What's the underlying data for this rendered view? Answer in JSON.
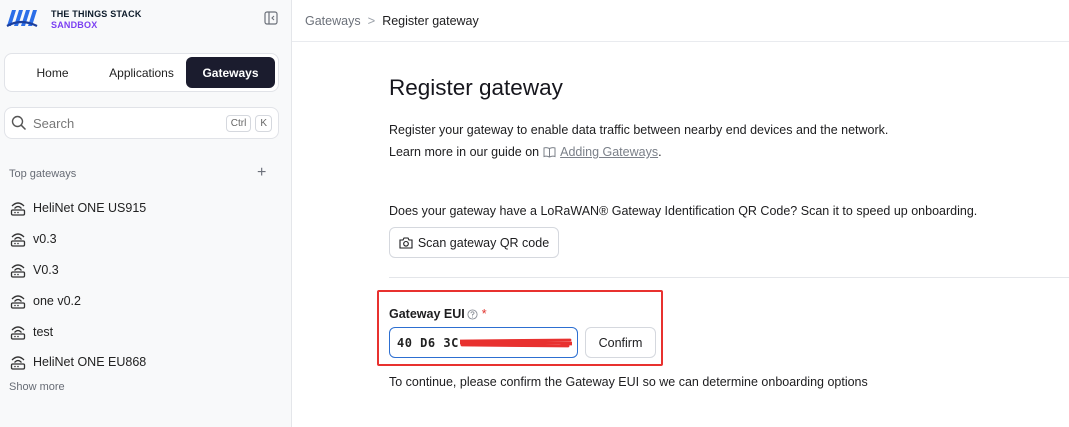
{
  "brand": {
    "line1": "THE THINGS STACK",
    "line2": "SANDBOX",
    "accent": "#7b3ff2"
  },
  "nav": {
    "tabs": [
      {
        "label": "Home"
      },
      {
        "label": "Applications"
      },
      {
        "label": "Gateways",
        "active": true
      }
    ]
  },
  "search": {
    "placeholder": "Search",
    "shortcut_key1": "Ctrl",
    "shortcut_key2": "K"
  },
  "sidebar": {
    "section_title": "Top gateways",
    "add_icon": "+",
    "gateways": [
      {
        "label": "HeliNet ONE US915"
      },
      {
        "label": "v0.3"
      },
      {
        "label": "V0.3"
      },
      {
        "label": "one v0.2"
      },
      {
        "label": "test"
      },
      {
        "label": "HeliNet ONE EU868"
      }
    ],
    "show_more": "Show more"
  },
  "breadcrumb": {
    "parent": "Gateways",
    "separator": ">",
    "current": "Register gateway"
  },
  "main": {
    "title": "Register gateway",
    "description": "Register your gateway to enable data traffic between nearby end devices and the network.",
    "guide_prefix": "Learn more in our guide on",
    "guide_link": "Adding Gateways",
    "guide_suffix": ".",
    "qr_question": "Does your gateway have a LoRaWAN® Gateway Identification QR Code? Scan it to speed up onboarding.",
    "qr_button": "Scan gateway QR code",
    "eui_label": "Gateway EUI",
    "required_mark": "*",
    "eui_value": "40 D6 3C",
    "confirm_button": "Confirm",
    "hint": "To continue, please confirm the Gateway EUI so we can determine onboarding options"
  },
  "colors": {
    "nav_active_bg": "#1b1c2e",
    "highlight_border": "#e8312f",
    "input_focus": "#2d6fd1",
    "redaction": "#e8312f"
  }
}
